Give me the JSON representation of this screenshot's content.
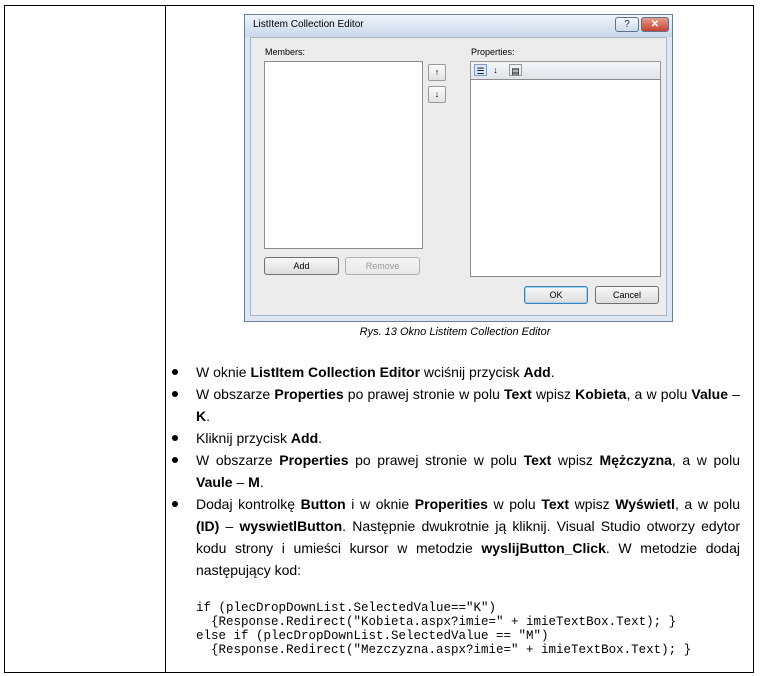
{
  "dialog": {
    "title": "ListItem Collection Editor",
    "help_label": "?",
    "close_label": "✕",
    "members_label": "Members:",
    "properties_label": "Properties:",
    "up_arrow": "↑",
    "down_arrow": "↓",
    "add_label": "Add",
    "remove_label": "Remove",
    "ok_label": "OK",
    "cancel_label": "Cancel",
    "toolbar_icons": [
      "categorized-icon",
      "alphabetical-icon",
      "property-pages-icon"
    ]
  },
  "caption": "Rys. 13 Okno Listitem Collection Editor",
  "steps": [
    [
      {
        "t": "W oknie "
      },
      {
        "t": "ListItem Collection Editor",
        "b": true
      },
      {
        "t": " wciśnij przycisk "
      },
      {
        "t": "Add",
        "b": true
      },
      {
        "t": "."
      }
    ],
    [
      {
        "t": "W obszarze "
      },
      {
        "t": "Properties",
        "b": true
      },
      {
        "t": " po prawej stronie w polu "
      },
      {
        "t": "Text",
        "b": true
      },
      {
        "t": " wpisz "
      },
      {
        "t": "Kobieta",
        "b": true
      },
      {
        "t": ", a w polu "
      },
      {
        "t": "Value",
        "b": true
      },
      {
        "t": " – "
      },
      {
        "t": "K",
        "b": true
      },
      {
        "t": "."
      }
    ],
    [
      {
        "t": "Kliknij przycisk "
      },
      {
        "t": "Add",
        "b": true
      },
      {
        "t": "."
      }
    ],
    [
      {
        "t": "W obszarze "
      },
      {
        "t": "Properties",
        "b": true
      },
      {
        "t": " po prawej stronie w polu "
      },
      {
        "t": "Text",
        "b": true
      },
      {
        "t": " wpisz "
      },
      {
        "t": "Mężczyzna",
        "b": true
      },
      {
        "t": ", a w polu "
      },
      {
        "t": "Vaule",
        "b": true
      },
      {
        "t": " – "
      },
      {
        "t": "M",
        "b": true
      },
      {
        "t": "."
      }
    ],
    [
      {
        "t": "Dodaj kontrolkę "
      },
      {
        "t": "Button",
        "b": true
      },
      {
        "t": " i w oknie "
      },
      {
        "t": "Properities",
        "b": true
      },
      {
        "t": " w polu "
      },
      {
        "t": "Text",
        "b": true
      },
      {
        "t": " wpisz "
      },
      {
        "t": "Wyświetl",
        "b": true
      },
      {
        "t": ", a w polu "
      },
      {
        "t": "(ID)",
        "b": true
      },
      {
        "t": " – "
      },
      {
        "t": "wyswietlButton",
        "b": true
      },
      {
        "t": ". Następnie dwukrotnie ją kliknij. Visual Studio otworzy edytor kodu strony i umieści kursor w metodzie "
      },
      {
        "t": "wyslijButton_Click",
        "b": true
      },
      {
        "t": ". W metodzie dodaj następujący kod:"
      }
    ]
  ],
  "code": "if (plecDropDownList.SelectedValue==\"K\")\n  {Response.Redirect(\"Kobieta.aspx?imie=\" + imieTextBox.Text); }\nelse if (plecDropDownList.SelectedValue == \"M\")\n  {Response.Redirect(\"Mezczyzna.aspx?imie=\" + imieTextBox.Text); }"
}
